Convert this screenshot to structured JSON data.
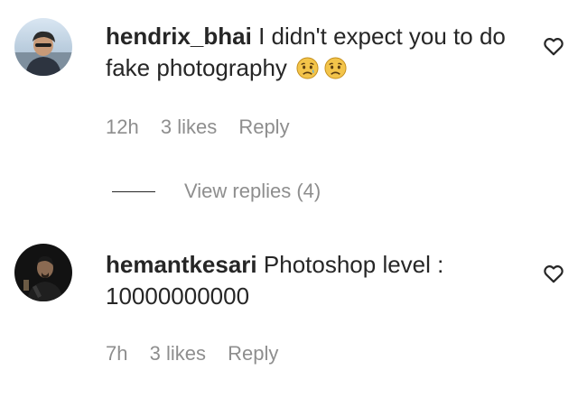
{
  "comments": [
    {
      "username": "hendrix_bhai",
      "text": "I didn't expect you to do fake photography",
      "emoji_icons": [
        "sad-relieved-face-icon",
        "frowning-face-icon"
      ],
      "time": "12h",
      "likes": "3 likes",
      "reply_label": "Reply",
      "view_replies_label": "View replies (4)"
    },
    {
      "username": "hemantkesari",
      "text": "Photoshop level : 10000000000",
      "time": "7h",
      "likes": "3 likes",
      "reply_label": "Reply"
    }
  ],
  "colors": {
    "text": "#262626",
    "meta": "#8e8e8e",
    "emoji": "#f3c44a"
  }
}
